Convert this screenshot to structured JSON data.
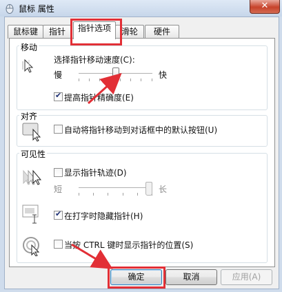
{
  "window": {
    "title": "鼠标 属性",
    "close_glyph": "✕"
  },
  "tabs": [
    {
      "label": "鼠标键"
    },
    {
      "label": "指针"
    },
    {
      "label": "指针选项"
    },
    {
      "label": "滑轮"
    },
    {
      "label": "硬件"
    }
  ],
  "motion": {
    "group_label": "移动",
    "speed_label": "选择指针移动速度(C):",
    "slow_label": "慢",
    "fast_label": "快",
    "speed_level_fraction": 0.5,
    "precision_label": "提高指针精确度(E)",
    "precision_checked": true
  },
  "snap": {
    "group_label": "对齐",
    "snap_label": "自动将指针移动到对话框中的默认按钮(U)",
    "snap_checked": false
  },
  "visibility": {
    "group_label": "可见性",
    "trails_label": "显示指针轨迹(D)",
    "trails_checked": false,
    "short_label": "短",
    "long_label": "长",
    "trail_level_fraction": 1.0,
    "hide_label": "在打字时隐藏指针(H)",
    "hide_checked": true,
    "ctrl_label": "当按 CTRL 键时显示指针的位置(S)",
    "ctrl_checked": false
  },
  "buttons": {
    "ok": "确定",
    "cancel": "取消",
    "apply": "应用(A)"
  },
  "annotation_color": "#e22f36"
}
